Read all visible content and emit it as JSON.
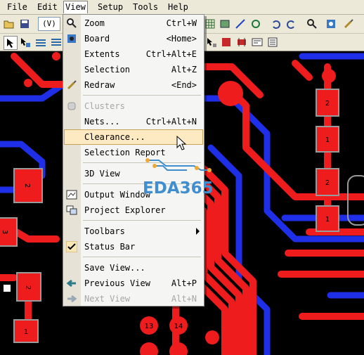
{
  "menubar": {
    "items": [
      {
        "label": "File",
        "active": false
      },
      {
        "label": "Edit",
        "active": false
      },
      {
        "label": "View",
        "active": true
      },
      {
        "label": "Setup",
        "active": false
      },
      {
        "label": "Tools",
        "active": false
      },
      {
        "label": "Help",
        "active": false
      }
    ]
  },
  "toolbar": {
    "combo_value": "(V)"
  },
  "view_menu": {
    "items": [
      {
        "label": "Zoom",
        "shortcut": "Ctrl+W",
        "icon": "magnifier-icon",
        "state": "normal"
      },
      {
        "label": "Board",
        "shortcut": "<Home>",
        "icon": "board-icon",
        "state": "normal"
      },
      {
        "label": "Extents",
        "shortcut": "Ctrl+Alt+E",
        "icon": "",
        "state": "normal"
      },
      {
        "label": "Selection",
        "shortcut": "Alt+Z",
        "icon": "",
        "state": "normal"
      },
      {
        "label": "Redraw",
        "shortcut": "<End>",
        "icon": "brush-icon",
        "state": "normal"
      },
      {
        "label": "Clusters",
        "shortcut": "",
        "icon": "clusters-icon",
        "state": "disabled"
      },
      {
        "label": "Nets...",
        "shortcut": "Ctrl+Alt+N",
        "icon": "",
        "state": "normal"
      },
      {
        "label": "Clearance...",
        "shortcut": "",
        "icon": "",
        "state": "highlighted"
      },
      {
        "label": "Selection Report",
        "shortcut": "",
        "icon": "",
        "state": "normal"
      },
      {
        "label": "3D View",
        "shortcut": "",
        "icon": "",
        "state": "normal"
      },
      {
        "label": "Output Window",
        "shortcut": "",
        "icon": "output-window-icon",
        "state": "normal"
      },
      {
        "label": "Project Explorer",
        "shortcut": "",
        "icon": "project-explorer-icon",
        "state": "normal"
      },
      {
        "label": "Toolbars",
        "shortcut": "",
        "icon": "",
        "state": "submenu"
      },
      {
        "label": "Status Bar",
        "shortcut": "",
        "icon": "checkmark-icon",
        "state": "checked"
      },
      {
        "label": "Save View...",
        "shortcut": "",
        "icon": "",
        "state": "normal"
      },
      {
        "label": "Previous View",
        "shortcut": "Alt+P",
        "icon": "back-arrow-icon",
        "state": "normal"
      },
      {
        "label": "Next View",
        "shortcut": "Alt+N",
        "icon": "forward-arrow-icon",
        "state": "disabled"
      }
    ]
  },
  "pcb": {
    "pad_labels": [
      "2",
      "1",
      "2",
      "1",
      "2",
      "3",
      "2",
      "1",
      "13",
      "14"
    ]
  },
  "watermark": {
    "text": "EDA365"
  },
  "colors": {
    "background": "#000000",
    "trace_red": "#ee1c1c",
    "trace_blue": "#1f2fe8",
    "menu_highlight": "#fde9c2"
  }
}
